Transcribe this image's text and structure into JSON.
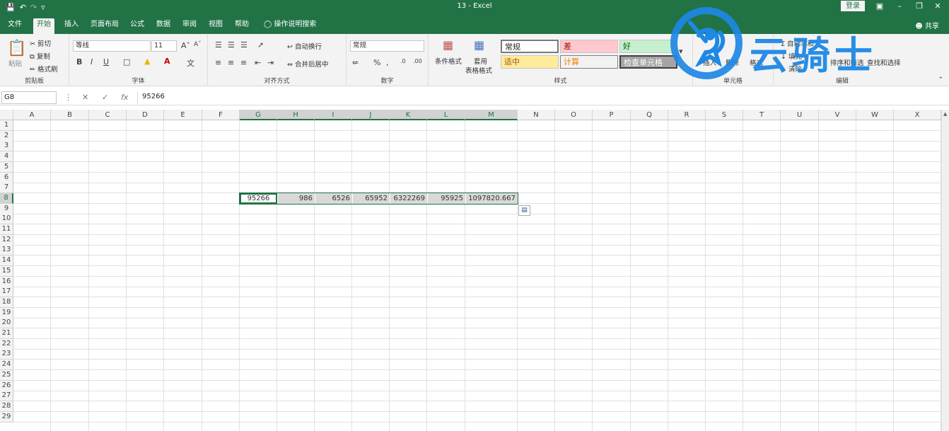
{
  "window": {
    "title": "13  -  Excel",
    "login": "登录",
    "share": "共享"
  },
  "menu": {
    "tabs": [
      "文件",
      "开始",
      "插入",
      "页面布局",
      "公式",
      "数据",
      "审阅",
      "视图",
      "帮助"
    ],
    "active_tab": "开始",
    "tell_me": "操作说明搜索"
  },
  "ribbon": {
    "clipboard": {
      "paste": "粘贴",
      "cut": "剪切",
      "copy": "复制",
      "format_painter": "格式刷",
      "label": "剪贴板"
    },
    "font": {
      "font_name": "等线",
      "font_size": "11",
      "bold": "B",
      "italic": "I",
      "underline": "U",
      "label": "字体"
    },
    "alignment": {
      "wrap_text": "自动换行",
      "merge_center": "合并后居中",
      "label": "对齐方式"
    },
    "number": {
      "format": "常规",
      "label": "数字"
    },
    "styles": {
      "conditional_format": "条件格式",
      "format_as_table_1": "套用",
      "format_as_table_2": "表格格式",
      "normal": "常规",
      "bad": "差",
      "good": "好",
      "neutral": "适中",
      "calculation": "计算",
      "check_cell": "检查单元格",
      "label": "样式"
    },
    "cells": {
      "insert": "插入",
      "delete": "删除",
      "format": "格式",
      "label": "单元格"
    },
    "editing": {
      "autosum": "自动求和",
      "fill": "填充",
      "clear": "清除",
      "sort_filter": "排序和筛选",
      "find_select": "查找和选择",
      "label": "编辑"
    }
  },
  "formula_bar": {
    "name_box": "G8",
    "fx": "fx",
    "value": "95266"
  },
  "grid": {
    "columns": [
      "A",
      "B",
      "C",
      "D",
      "E",
      "F",
      "G",
      "H",
      "I",
      "J",
      "K",
      "L",
      "M",
      "N",
      "O",
      "P",
      "Q",
      "R",
      "S",
      "T",
      "U",
      "V",
      "W",
      "X"
    ],
    "rows": [
      "1",
      "2",
      "3",
      "4",
      "5",
      "6",
      "7",
      "8",
      "9",
      "10",
      "11",
      "12",
      "13",
      "14",
      "15",
      "16",
      "17",
      "18",
      "19",
      "20",
      "21",
      "22",
      "23",
      "24",
      "25",
      "26",
      "27",
      "28",
      "29"
    ],
    "row8_values": [
      "95266",
      "986",
      "6526",
      "65952",
      "6322269",
      "95925",
      "1097820.667"
    ]
  },
  "watermark": {
    "text": "云骑士"
  },
  "colors": {
    "accent": "#217346",
    "watermark": "#1e88e5"
  }
}
